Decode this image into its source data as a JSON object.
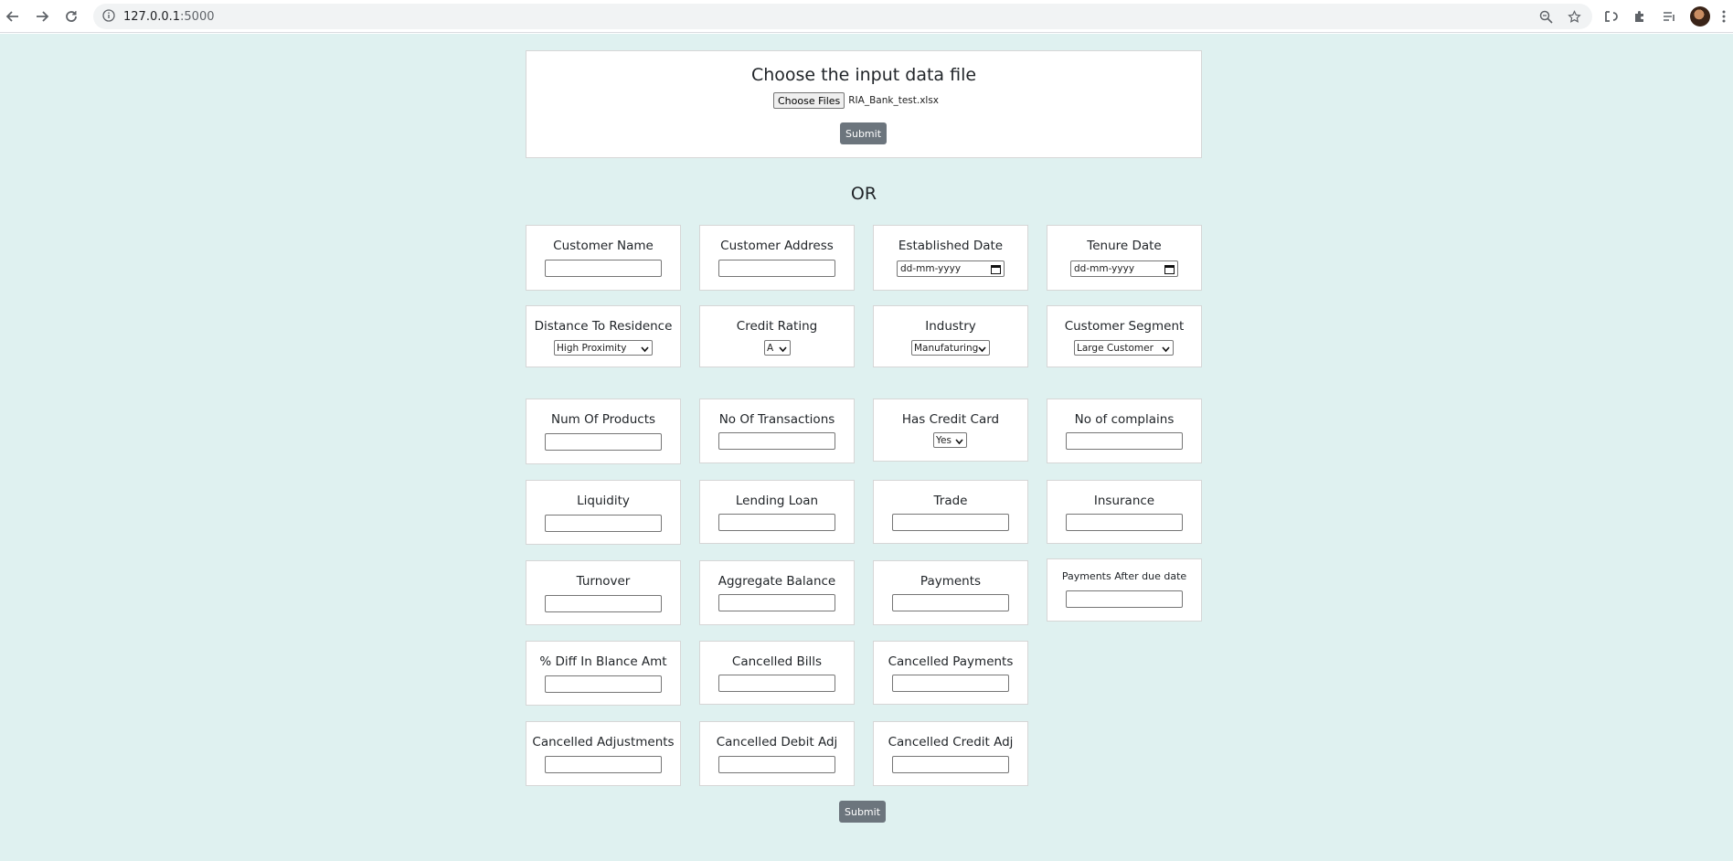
{
  "browser": {
    "url_host": "127.0.0.1",
    "url_port": ":5000"
  },
  "upload": {
    "title": "Choose the input data file",
    "choose_button": "Choose Files",
    "file_name": "RIA_Bank_test.xlsx",
    "submit_label": "Submit"
  },
  "or_label": "OR",
  "form": {
    "customer_name": "Customer Name",
    "customer_address": "Customer Address",
    "established_date": "Established Date",
    "established_date_value": "dd-mm-yyyy",
    "tenure_date": "Tenure Date",
    "tenure_date_value": "dd-mm-yyyy",
    "distance_to_residence": "Distance To Residence",
    "distance_value": "High Proximity",
    "credit_rating": "Credit Rating",
    "credit_rating_value": "A",
    "industry": "Industry",
    "industry_value": "Manufaturing",
    "customer_segment": "Customer Segment",
    "customer_segment_value": "Large Customer",
    "num_of_products": "Num Of Products",
    "no_of_transactions": "No Of Transactions",
    "has_credit_card": "Has Credit Card",
    "has_credit_card_value": "Yes",
    "no_of_complains": "No of complains",
    "liquidity": "Liquidity",
    "lending_loan": "Lending Loan",
    "trade": "Trade",
    "insurance": "Insurance",
    "turnover": "Turnover",
    "aggregate_balance": "Aggregate Balance",
    "payments": "Payments",
    "payments_after_due_date": "Payments After due date",
    "pct_diff_balance": "% Diff In Blance Amt",
    "cancelled_bills": "Cancelled Bills",
    "cancelled_payments": "Cancelled Payments",
    "cancelled_adjustments": "Cancelled Adjustments",
    "cancelled_debit_adj": "Cancelled Debit Adj",
    "cancelled_credit_adj": "Cancelled Credit Adj",
    "submit_label": "Submit"
  }
}
